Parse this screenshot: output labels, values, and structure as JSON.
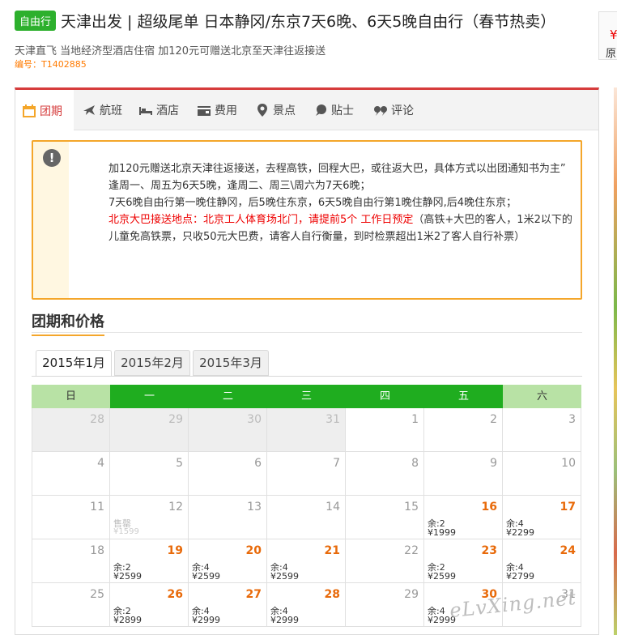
{
  "header": {
    "tag": "自由行",
    "title": "天津出发 | 超级尾单 日本静冈/东京7天6晚、6天5晚自由行（春节热卖）",
    "subtitle": "天津直飞 当地经济型酒店住宿 加120元可赠送北京至天津往返接送",
    "code": "编号：T1402885"
  },
  "right_panel": {
    "symbol": "¥",
    "text": "原"
  },
  "tabs": [
    {
      "label": "团期",
      "icon": "calendar-icon"
    },
    {
      "label": "航班",
      "icon": "plane-icon"
    },
    {
      "label": "酒店",
      "icon": "bed-icon"
    },
    {
      "label": "费用",
      "icon": "wallet-icon"
    },
    {
      "label": "景点",
      "icon": "pin-icon"
    },
    {
      "label": "贴士",
      "icon": "chat-icon"
    },
    {
      "label": "评论",
      "icon": "quote-icon"
    }
  ],
  "notice": {
    "line1": "加120元赠送北京天津往返接送，去程高铁，回程大巴，或往返大巴，具体方式以出团通知书为主”",
    "line2": "逢周一、周五为6天5晚，逢周二、周三\\周六为7天6晚；",
    "line3": "7天6晚自由行第一晚住静冈，后5晚住东京，6天5晚自由行第1晚住静冈,后4晚住东京；",
    "line4_red": "北京大巴接送地点：北京工人体育场北门，请提前5个 工作日预定",
    "line4_rest": "（高铁+大巴的客人，1米2以下的儿童免高铁票，只收50元大巴费，请客人自行衡量，到时检票超出1米2了客人自行补票）"
  },
  "section_title": "团期和价格",
  "month_tabs": [
    "2015年1月",
    "2015年2月",
    "2015年3月"
  ],
  "weekdays": [
    "日",
    "一",
    "二",
    "三",
    "四",
    "五",
    "六"
  ],
  "calendar": [
    [
      {
        "d": "28",
        "g": true
      },
      {
        "d": "29",
        "g": true
      },
      {
        "d": "30",
        "g": true
      },
      {
        "d": "31",
        "g": true
      },
      {
        "d": "1"
      },
      {
        "d": "2"
      },
      {
        "d": "3"
      }
    ],
    [
      {
        "d": "4"
      },
      {
        "d": "5"
      },
      {
        "d": "6"
      },
      {
        "d": "7"
      },
      {
        "d": "8"
      },
      {
        "d": "9"
      },
      {
        "d": "10"
      }
    ],
    [
      {
        "d": "11"
      },
      {
        "d": "12",
        "sold": "售罄",
        "sp": "¥1599"
      },
      {
        "d": "13"
      },
      {
        "d": "14"
      },
      {
        "d": "15"
      },
      {
        "d": "16",
        "r": "余:2",
        "p": "¥1999"
      },
      {
        "d": "17",
        "r": "余:4",
        "p": "¥2299"
      }
    ],
    [
      {
        "d": "18"
      },
      {
        "d": "19",
        "r": "余:2",
        "p": "¥2599"
      },
      {
        "d": "20",
        "r": "余:4",
        "p": "¥2599"
      },
      {
        "d": "21",
        "r": "余:4",
        "p": "¥2599"
      },
      {
        "d": "22"
      },
      {
        "d": "23",
        "r": "余:2",
        "p": "¥2599"
      },
      {
        "d": "24",
        "r": "余:4",
        "p": "¥2799"
      }
    ],
    [
      {
        "d": "25"
      },
      {
        "d": "26",
        "r": "余:2",
        "p": "¥2899"
      },
      {
        "d": "27",
        "r": "余:4",
        "p": "¥2999"
      },
      {
        "d": "28",
        "r": "余:4",
        "p": "¥2999"
      },
      {
        "d": "29"
      },
      {
        "d": "30",
        "r": "余:4",
        "p": "¥2999"
      },
      {
        "d": "31"
      }
    ]
  ],
  "watermark": "eLvXing.net"
}
